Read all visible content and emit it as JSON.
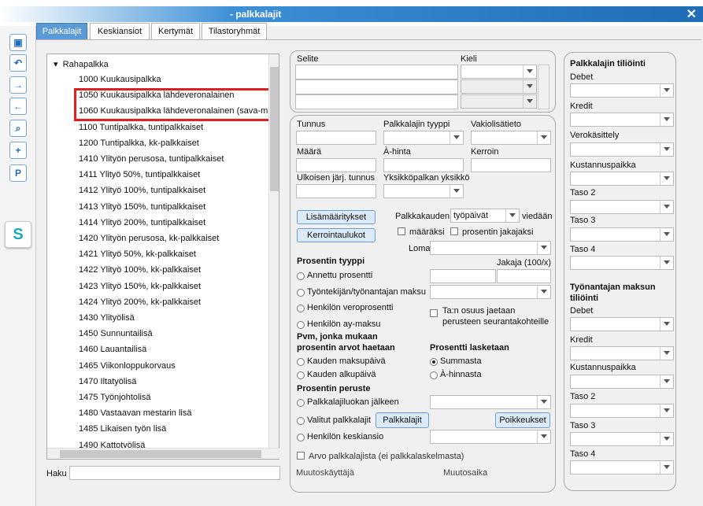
{
  "window": {
    "title": "- palkkalajit",
    "close": "✕"
  },
  "sidebar": {
    "buttons": [
      "save-icon",
      "undo-icon",
      "forward-icon",
      "back-icon",
      "search-icon",
      "add-doc-icon"
    ],
    "p_label": "P",
    "logo": "S"
  },
  "tabs": [
    "Palkkalajit",
    "Keskiansiot",
    "Kertymät",
    "Tilastoryhmät"
  ],
  "tree": {
    "root": "Rahapalkka",
    "items": [
      "1000 Kuukausipalkka",
      "1050 Kuukausipalkka lähdeveronalainen",
      "1060 Kuukausipalkka lähdeveronalainen (sava-mal",
      "1100 Tuntipalkka, tuntipalkkaiset",
      "1200 Tuntipalkka, kk-palkkaiset",
      "1410 Ylityön perusosa, tuntipalkkaiset",
      "1411 Ylityö 50%, tuntipalkkaiset",
      "1412 Ylityö 100%, tuntipalkkaiset",
      "1413 Ylityö 150%, tuntipalkkaiset",
      "1414 Ylityö 200%, tuntipalkkaiset",
      "1420 Ylityön perusosa, kk-palkkaiset",
      "1421 Ylityö 50%, kk-palkkaiset",
      "1422 Ylityö 100%, kk-palkkaiset",
      "1423 Ylityö 150%, kk-palkkaiset",
      "1424 Ylityö 200%, kk-palkkaiset",
      "1430 Ylityölisä",
      "1450 Sunnuntailisä",
      "1460 Lauantailisä",
      "1465 Viikonloppukorvaus",
      "1470 Iltatyölisä",
      "1475 Työnjohtolisä",
      "1480 Vastaavan mestarin lisä",
      "1485 Likaisen työn lisä",
      "1490 Kattotyölisä"
    ]
  },
  "search": {
    "label": "Haku",
    "value": ""
  },
  "selite": {
    "col1": "Selite",
    "col2": "Kieli"
  },
  "form": {
    "tunnus": "Tunnus",
    "tyyppi": "Palkkalajin tyyppi",
    "vakio": "Vakiolisätieto",
    "maara": "Määrä",
    "ahinta": "À-hinta",
    "kerroin": "Kerroin",
    "ulkoinen": "Ulkoisen järj. tunnus",
    "yksikko": "Yksikköpalkan yksikkö",
    "lisamaar": "Lisämääritykset",
    "kerroin_btn": "Kerrointaulukot",
    "palkkakauden": "Palkkakauden",
    "palkkakauden_val": "työpäivät",
    "viedaan": "viedään",
    "maaraksi": "määräksi",
    "prosentin_jakajaksi": "prosentin jakajaksi",
    "loma": "Loma",
    "prosentin_tyyppi": "Prosentin tyyppi",
    "jakaja": "Jakaja (100/x)",
    "r1": "Annettu prosentti",
    "r2": "Työntekijän/työnantajan maksu",
    "r3": "Henkilön veroprosentti",
    "r4": "Henkilön ay-maksu",
    "ta_osuus": "Ta:n osuus jaetaan",
    "ta_osuus2": "perusteen seurantakohteille",
    "pvm1": "Pvm, jonka mukaan",
    "pvm2": "prosentin arvot haetaan",
    "pr_lasketaan": "Prosentti lasketaan",
    "kmp": "Kauden maksupäivä",
    "kap": "Kauden alkupäivä",
    "summasta": "Summasta",
    "ahinnasta": "À-hinnasta",
    "peruste": "Prosentin peruste",
    "pl1": "Palkkalajiluokan jälkeen",
    "pl2": "Valitut palkkalajit",
    "pl3": "Henkilön keskiansio",
    "palkkalajit_btn": "Palkkalajit",
    "poikkeukset_btn": "Poikkeukset",
    "arvo": "Arvo palkkalajista (ei palkkalaskelmasta)",
    "muutoskayttaja": "Muutoskäyttäjä",
    "muutosaika": "Muutosaika"
  },
  "right": {
    "title": "Palkkalajin tiliöinti",
    "debet": "Debet",
    "kredit": "Kredit",
    "vero": "Verokäsittely",
    "kustannus": "Kustannuspaikka",
    "taso2": "Taso 2",
    "taso3": "Taso 3",
    "taso4": "Taso 4",
    "title2a": "Työnantajan maksun",
    "title2b": "tiliöinti"
  }
}
